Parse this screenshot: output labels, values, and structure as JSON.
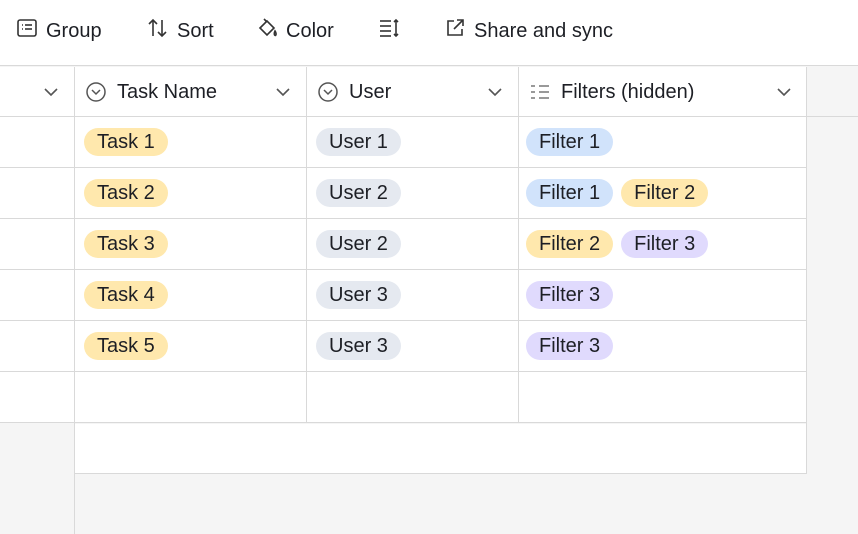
{
  "toolbar": {
    "group_label": "Group",
    "sort_label": "Sort",
    "color_label": "Color",
    "share_label": "Share and sync"
  },
  "columns": {
    "task_name": "Task Name",
    "user": "User",
    "filters": "Filters (hidden)"
  },
  "rows": [
    {
      "task": "Task 1",
      "user": "User 1",
      "filters": [
        "Filter 1"
      ]
    },
    {
      "task": "Task 2",
      "user": "User 2",
      "filters": [
        "Filter 1",
        "Filter 2"
      ]
    },
    {
      "task": "Task 3",
      "user": "User 2",
      "filters": [
        "Filter 2",
        "Filter 3"
      ]
    },
    {
      "task": "Task 4",
      "user": "User 3",
      "filters": [
        "Filter 3"
      ]
    },
    {
      "task": "Task 5",
      "user": "User 3",
      "filters": [
        "Filter 3"
      ]
    }
  ],
  "colors": {
    "task_pill": "#ffe8ad",
    "user_pill": "#e5e9f0",
    "filter_1": "#d1e3fb",
    "filter_2": "#ffe8ad",
    "filter_3": "#e0dafd"
  }
}
